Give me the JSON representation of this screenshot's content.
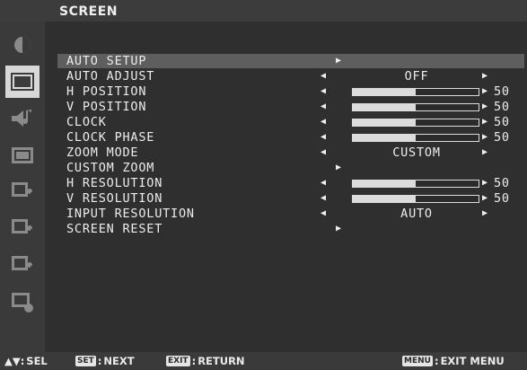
{
  "header": {
    "title": "SCREEN"
  },
  "sidebar": {
    "items": [
      {
        "icon": "picture-icon",
        "active": false
      },
      {
        "icon": "screen-icon",
        "active": true
      },
      {
        "icon": "audio-icon",
        "active": false
      },
      {
        "icon": "pip-icon",
        "active": false
      },
      {
        "icon": "setup-icon",
        "active": false
      },
      {
        "icon": "advanced-icon",
        "active": false
      },
      {
        "icon": "multi-display-icon",
        "active": false
      },
      {
        "icon": "information-icon",
        "active": false
      }
    ]
  },
  "menu": {
    "items": [
      {
        "label": "AUTO SETUP",
        "control": "submenu"
      },
      {
        "label": "AUTO ADJUST",
        "control": "select",
        "value": "OFF"
      },
      {
        "label": "H POSITION",
        "control": "slider",
        "value": 50
      },
      {
        "label": "V POSITION",
        "control": "slider",
        "value": 50
      },
      {
        "label": "CLOCK",
        "control": "slider",
        "value": 50
      },
      {
        "label": "CLOCK PHASE",
        "control": "slider",
        "value": 50
      },
      {
        "label": "ZOOM MODE",
        "control": "select",
        "value": "CUSTOM"
      },
      {
        "label": "CUSTOM ZOOM",
        "control": "submenu"
      },
      {
        "label": "H RESOLUTION",
        "control": "slider",
        "value": 50
      },
      {
        "label": "V RESOLUTION",
        "control": "slider",
        "value": 50
      },
      {
        "label": "INPUT RESOLUTION",
        "control": "select",
        "value": "AUTO"
      },
      {
        "label": "SCREEN RESET",
        "control": "submenu"
      }
    ]
  },
  "footer": {
    "sel_label": "SEL",
    "set_key": "SET",
    "next_label": "NEXT",
    "exit_key": "EXIT",
    "return_label": "RETURN",
    "menu_key": "MENU",
    "exit_menu_label": "EXIT MENU"
  },
  "colors": {
    "highlight": "#5e5e5e",
    "active_tab": "#d8d8d8",
    "background": "#2f2f2f"
  }
}
